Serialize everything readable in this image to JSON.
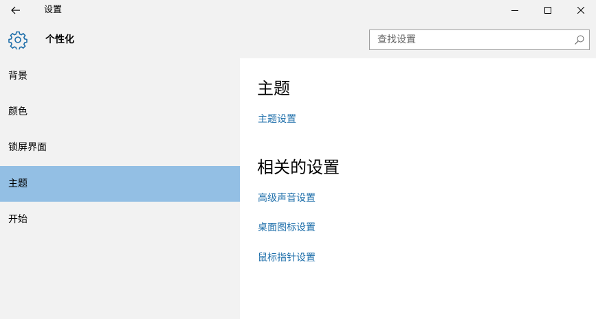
{
  "window": {
    "title": "设置",
    "back_icon": "back-arrow-icon",
    "controls": [
      "minimize-icon",
      "maximize-icon",
      "close-icon"
    ]
  },
  "header": {
    "icon": "gear-icon",
    "title": "个性化",
    "search_placeholder": "查找设置",
    "search_value": "",
    "search_icon": "search-icon"
  },
  "sidebar": {
    "items": [
      {
        "label": "背景"
      },
      {
        "label": "颜色"
      },
      {
        "label": "锁屏界面"
      },
      {
        "label": "主题",
        "selected": true
      },
      {
        "label": "开始"
      }
    ]
  },
  "main": {
    "heading": "主题",
    "theme_settings_link": "主题设置",
    "related_heading": "相关的设置",
    "related_links": [
      "高级声音设置",
      "桌面图标设置",
      "鼠标指针设置"
    ]
  },
  "colors": {
    "accent": "#1d6eaa",
    "selection": "#93bfe4",
    "chrome": "#f2f2f2"
  }
}
